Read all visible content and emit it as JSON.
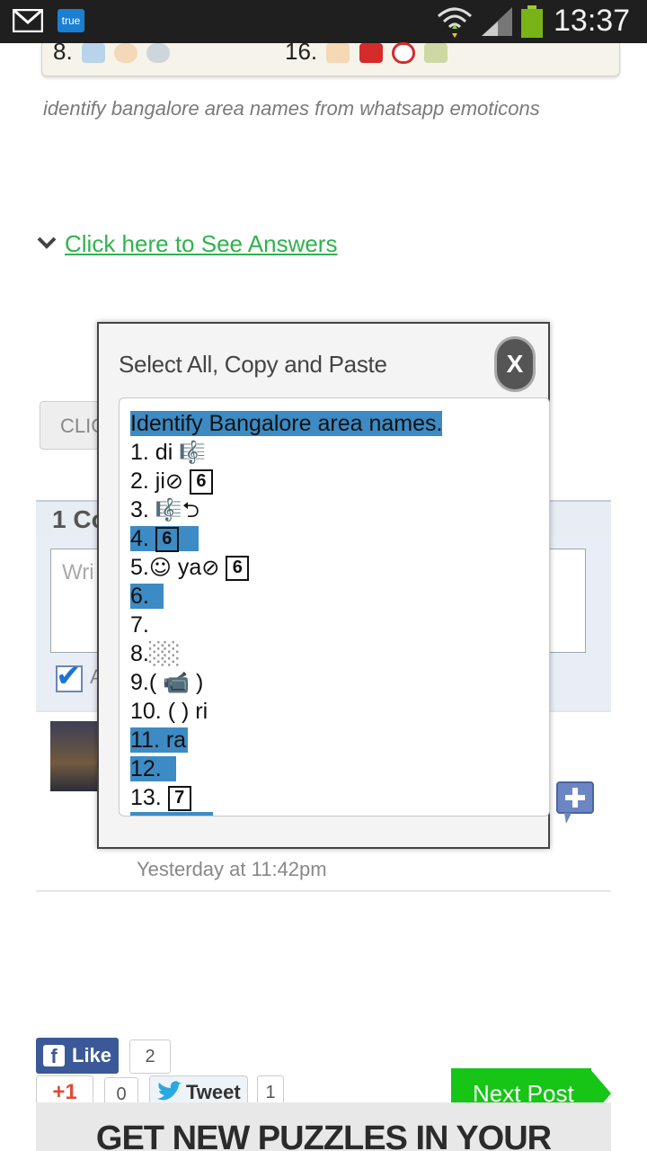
{
  "status_bar": {
    "time": "13:37",
    "true_badge": "true",
    "icons": [
      "gmail-icon",
      "wifi-icon",
      "signal-icon",
      "battery-icon"
    ]
  },
  "puzzle_strip": {
    "left_number": "8.",
    "right_number": "16."
  },
  "caption": "identify bangalore area names from whatsapp emoticons",
  "answers_link": "Click here to See Answers",
  "background": {
    "click_button": "CLIC",
    "comments_header": "1 Co",
    "comment_placeholder": "Wri",
    "check_label": "A",
    "comment_time": "Yesterday at 11:42pm"
  },
  "modal": {
    "title": "Select All, Copy and Paste",
    "close_label": "X",
    "lines": {
      "l0": "Identify Bangalore area names.",
      "l1": "1. di",
      "l2": "2. ji",
      "l3": "3.",
      "l4": "4.",
      "l5a": "5.",
      "l5b": "ya",
      "l6": "6.",
      "l7": "7.",
      "l8": "8.",
      "l9a": "9.(",
      "l9b": ")",
      "l10": "10. (   ) ri",
      "l11": "11.   ra",
      "l12": "12.",
      "l13": "13."
    },
    "boxed": {
      "six": "6",
      "seven": "7"
    }
  },
  "social": {
    "like_label": "Like",
    "like_count": "2",
    "gplus_label": "+1",
    "gplus_count": "0",
    "tweet_label": "Tweet",
    "tweet_count": "1",
    "next_post": "Next Post"
  },
  "footer_banner": "GET NEW PUZZLES IN YOUR",
  "colors": {
    "link_green": "#2fb34d",
    "selection_blue": "#3d8bc4",
    "next_green": "#16c516",
    "facebook_blue": "#3b5998"
  }
}
